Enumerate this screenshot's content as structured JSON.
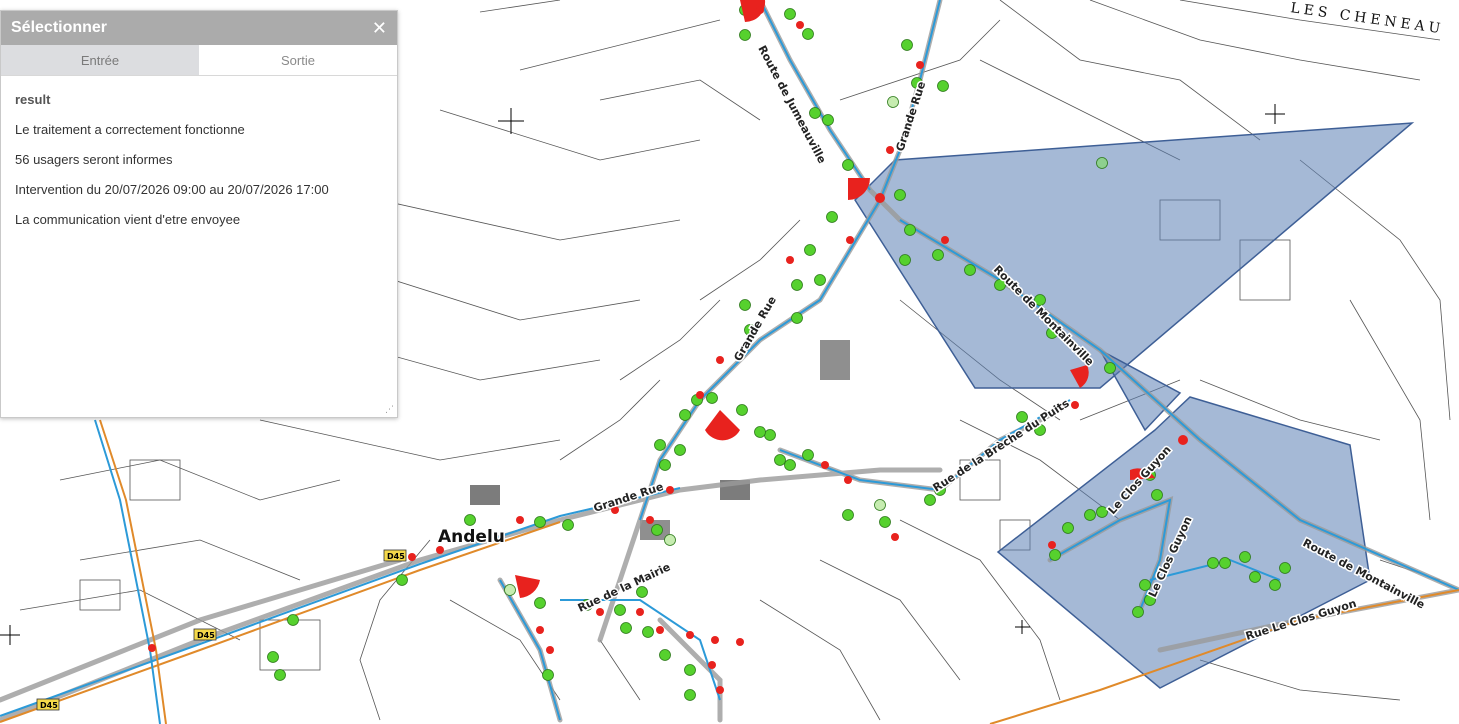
{
  "panel": {
    "title": "Sélectionner",
    "close_icon": "close-icon",
    "tabs": [
      {
        "label": "Entrée",
        "active": false
      },
      {
        "label": "Sortie",
        "active": true
      }
    ],
    "result_label": "result",
    "messages": [
      "Le traitement a correctement fonctionne",
      "56 usagers seront informes",
      "Intervention du 20/07/2026 09:00 au 20/07/2026 17:00",
      "La communication vient d'etre envoyee"
    ]
  },
  "map": {
    "place": "Andelu",
    "corner_label": "LES CHENEAU",
    "road_shields": [
      "D45",
      "D45",
      "D45"
    ],
    "roads": [
      "Route de Jumeauville",
      "Grande Rue",
      "Grande Rue",
      "Route de Montainville",
      "Rue de la Brèche du Puits",
      "Grande Rue",
      "Rue de la Mairie",
      "Le Clos Guyon",
      "Le Clos Guyon",
      "Route de Montainville",
      "Rue Le Clos Guyon"
    ],
    "colors": {
      "selection_fill": "#5b7fb5",
      "valve_red": "#e8221e",
      "user_green": "#56d12e",
      "pipe_blue": "#2c9ad8",
      "pipe_orange": "#e08a2a"
    }
  }
}
